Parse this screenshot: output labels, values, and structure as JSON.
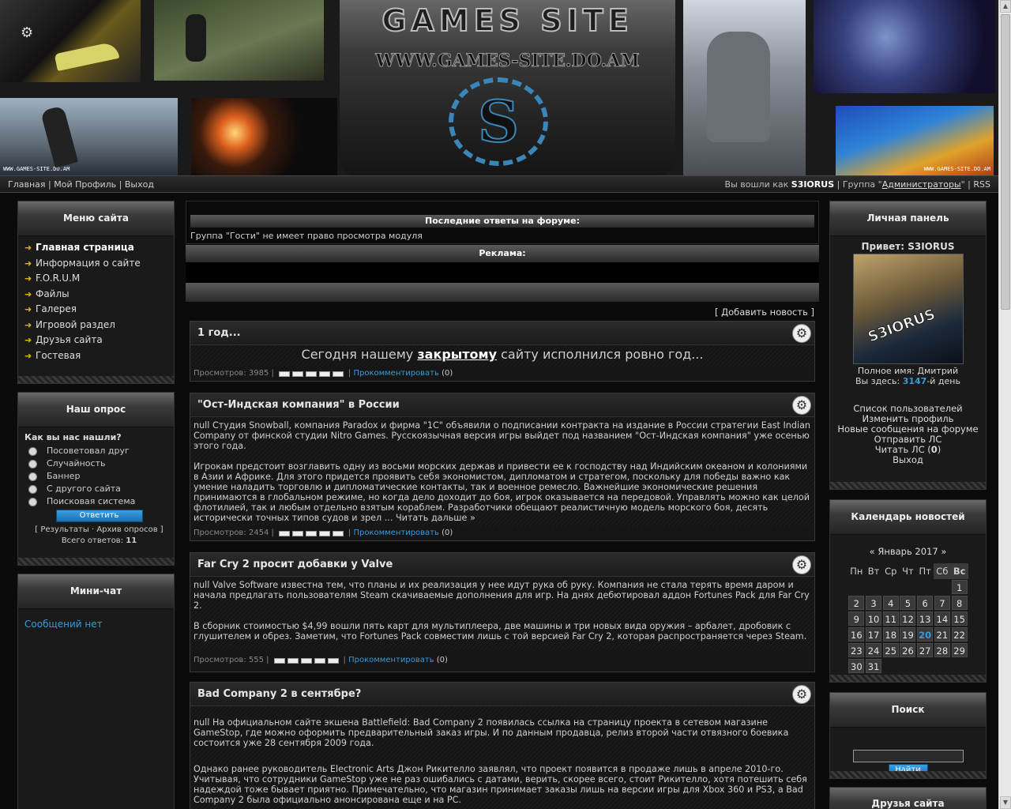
{
  "header": {
    "logo_title": "GAMES SITE",
    "logo_url": "WWW.GAMES-SITE.DO.AM",
    "logo_letter": "S",
    "watermark": "WWW.GAMES-SITE.DO.AM"
  },
  "topbar": {
    "nav": [
      "Главная",
      "Мой Профиль",
      "Выход"
    ],
    "logged_prefix": "Вы вошли как",
    "username": "S3IORUS",
    "group_prefix": "Группа \"",
    "group": "Администраторы",
    "group_suffix": "\"",
    "rss": "RSS"
  },
  "menu": {
    "title": "Меню сайта",
    "items": [
      "Главная страница",
      "Информация о сайте",
      "F.O.R.U.M",
      "Файлы",
      "Галерея",
      "Игровой раздел",
      "Друзья сайта",
      "Гостевая"
    ]
  },
  "poll": {
    "title": "Наш опрос",
    "question": "Как вы нас нашли?",
    "options": [
      "Посоветовал друг",
      "Случайность",
      "Баннер",
      "С другого сайта",
      "Поисковая система"
    ],
    "submit": "Ответить",
    "results": "Результаты",
    "archive": "Архив опросов",
    "total_label": "Всего ответов:",
    "total": "11"
  },
  "minichat": {
    "title": "Мини-чат",
    "empty": "Сообщений нет"
  },
  "center": {
    "forum_bar": "Последние ответы на форуме:",
    "forum_notice": "Группа \"Гости\" не имеет право просмотра модуля",
    "ads_bar": "Реклама:",
    "add_news": "[ Добавить новость ]"
  },
  "news": [
    {
      "title": "1 год...",
      "text_pre": "Сегодня нашему ",
      "text_bold": "закрытому",
      "text_post": " сайту исполнился ровно год...",
      "views": "Просмотров: 3985",
      "comment": "Прокомментировать",
      "count": "(0)"
    },
    {
      "title": "\"Ост-Индская компания\" в России",
      "p1": "null Студия Snowball, компания Paradox и фирма \"1С\" объявили о подписании контракта на издание в России стратегии East Indian Company от финской студии Nitro Games. Русскоязычная версия игры выйдет под названием \"Ост-Индская компания\" уже осенью этого года.",
      "p2": "Игрокам предстоит возглавить одну из восьми морских держав и привести ее к господству над Индийским океаном и колониями в Азии и Африке. Для этого придется проявить себя экономистом, дипломатом и стратегом, поскольку для победы важно как умение наладить торговлю и дипломатические контакты, так и военное ремесло. Важнейшие экономические решения принимаются в глобальном режиме, но когда дело доходит до боя, игрок оказывается на передовой. Управлять можно как целой флотилией, так и любым отдельно взятым кораблем. Разработчики обещают реалистичную модель морского боя, десять исторически точных типов судов и зрел ... Читать дальше »",
      "views": "Просмотров: 2454",
      "comment": "Прокомментировать",
      "count": "(0)"
    },
    {
      "title": "Far Cry 2 просит добавки у Valve",
      "p1": "null Valve Software известна тем, что планы и их реализация у нее идут рука об руку. Компания не стала терять время даром и начала предлагать пользователям Steam скачиваемые дополнения для игр. На днях дебютировал аддон Fortunes Pack для Far Cry 2.",
      "p2": "В сборник стоимостью $4,99 вошли пять карт для мультиплеера, две машины и три новых вида оружия – арбалет, дробовик с глушителем и обрез. Заметим, что Fortunes Pack совместим лишь с той версией Far Cry 2, которая распространяется через Steam.",
      "views": "Просмотров: 555",
      "comment": "Прокомментировать",
      "count": "(0)"
    },
    {
      "title": "Bad Company 2 в сентябре?",
      "p1": "null На официальном сайте экшена Battlefield: Bad Company 2 появилась ссылка на страницу проекта в сетевом магазине GameStop, где можно оформить предварительный заказ игры. И по данным продавца, релиз второй части отвязного боевика состоится уже 28 сентября 2009 года.",
      "p2": "Однако ранее руководитель Electronic Arts Джон Рикителло заявлял, что проект появится в продаже лишь в апреле 2010-го. Учитывая, что сотрудники GameStop уже не раз ошибались с датами, верить, скорее всего, стоит Рикителло, хотя потешить себя надеждой тоже бывает приятно. Примечательно, что магазин принимает заказы лишь на версии игры для Xbox 360 и PS3, а Bad Company 2 была официально анонсирована еще и на PC."
    }
  ],
  "personal": {
    "title": "Личная панель",
    "greeting": "Привет: S3IORUS",
    "avatar_text": "S3IORUS",
    "fullname": "Полное имя: Дмитрий",
    "here_pre": "Вы здесь: ",
    "here_days": "3147",
    "here_post": "-й день",
    "links": [
      "Список пользователей",
      "Изменить профиль",
      "Новые сообщения на форуме",
      "Отправить ЛС"
    ],
    "read_pm": "Читать ЛС (",
    "read_pm_count": "0",
    "read_pm_end": ")",
    "logout": "Выход"
  },
  "calendar": {
    "title": "Календарь новостей",
    "month": "«  Январь 2017  »",
    "days": [
      "Пн",
      "Вт",
      "Ср",
      "Чт",
      "Пт",
      "Сб",
      "Вс"
    ],
    "weeks": [
      [
        "",
        "",
        "",
        "",
        "",
        "",
        "1"
      ],
      [
        "2",
        "3",
        "4",
        "5",
        "6",
        "7",
        "8"
      ],
      [
        "9",
        "10",
        "11",
        "12",
        "13",
        "14",
        "15"
      ],
      [
        "16",
        "17",
        "18",
        "19",
        "20",
        "21",
        "22"
      ],
      [
        "23",
        "24",
        "25",
        "26",
        "27",
        "28",
        "29"
      ],
      [
        "30",
        "31",
        "",
        "",
        "",
        "",
        ""
      ]
    ],
    "today": "20"
  },
  "search": {
    "title": "Поиск",
    "button": "Найти"
  },
  "friends": {
    "title": "Друзья сайта"
  },
  "colors": {
    "accent": "#3a9ad9",
    "arrow": "#e0b400",
    "background": "#0b0b0b"
  }
}
